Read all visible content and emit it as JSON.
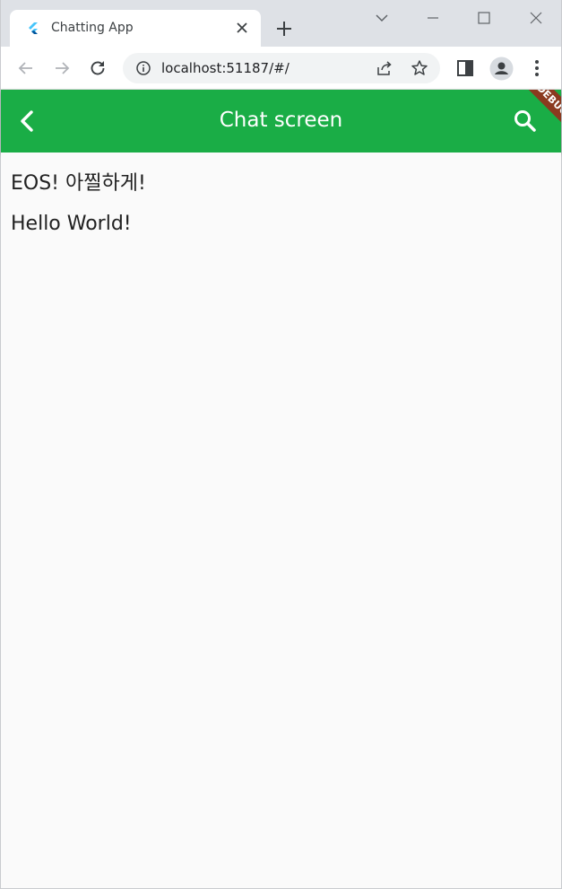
{
  "browser": {
    "tab_title": "Chatting App",
    "url": "localhost:51187/#/"
  },
  "app": {
    "title": "Chat screen",
    "debug_banner": "DEBUG",
    "accent_color": "#1aad46"
  },
  "messages": [
    {
      "text": "EOS! 아찔하게!"
    },
    {
      "text": "Hello World!"
    }
  ],
  "icons": {
    "favicon": "flutter-logo",
    "back": "chevron-left-icon",
    "search": "search-icon"
  }
}
